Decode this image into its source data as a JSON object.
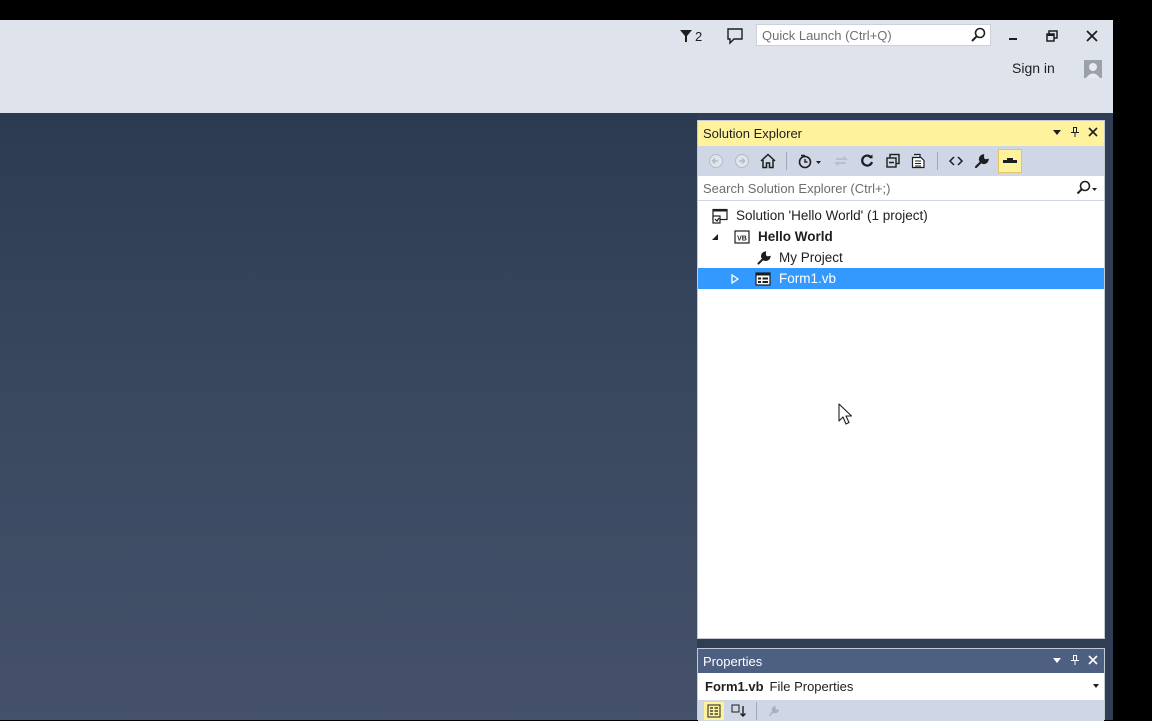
{
  "titlebar": {
    "notification_count": "2",
    "quick_launch_placeholder": "Quick Launch (Ctrl+Q)",
    "sign_in_label": "Sign in"
  },
  "solution_explorer": {
    "title": "Solution Explorer",
    "search_placeholder": "Search Solution Explorer (Ctrl+;)",
    "tree": {
      "solution": "Solution 'Hello World' (1 project)",
      "project": "Hello World",
      "my_project": "My Project",
      "form": "Form1.vb"
    },
    "project_badge": "VB"
  },
  "properties": {
    "title": "Properties",
    "object_name": "Form1.vb",
    "object_type": "File Properties"
  },
  "colors": {
    "active_header": "#fff29d",
    "inactive_header": "#4d6082",
    "selection": "#3399ff",
    "titlebar": "#dfe3ec",
    "editor_bg": "#2c3a52"
  }
}
